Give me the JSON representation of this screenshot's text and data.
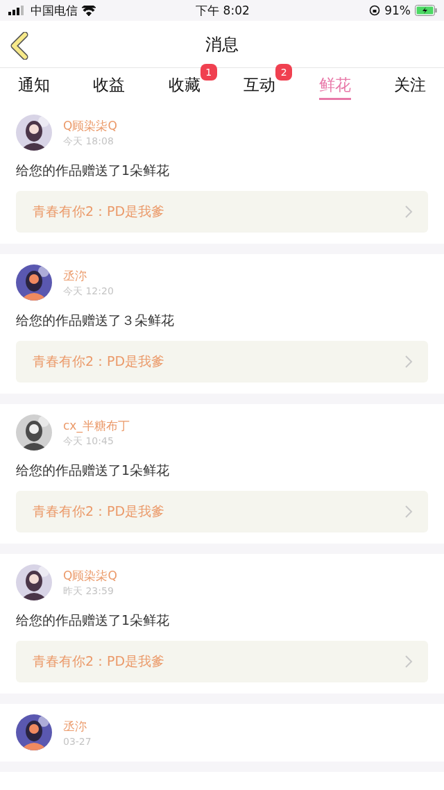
{
  "status_bar": {
    "carrier": "中国电信",
    "time": "下午 8:02",
    "battery": "91%"
  },
  "header": {
    "title": "消息"
  },
  "tabs": [
    {
      "label": "通知",
      "selected": false
    },
    {
      "label": "收益",
      "selected": false
    },
    {
      "label": "收藏",
      "selected": false,
      "badge": "1"
    },
    {
      "label": "互动",
      "selected": false,
      "badge": "2"
    },
    {
      "label": "鲜花",
      "selected": true
    },
    {
      "label": "关注",
      "selected": false
    }
  ],
  "messages": [
    {
      "name": "Q顾染柒Q",
      "time": "今天 18:08",
      "text": "给您的作品赠送了1朵鲜花",
      "work": "青春有你2：PD是我爹"
    },
    {
      "name": "丞沵",
      "time": "今天 12:20",
      "text": "给您的作品赠送了３朵鲜花",
      "work": "青春有你2：PD是我爹"
    },
    {
      "name": "cx_半糖布丁",
      "time": "今天 10:45",
      "text": "给您的作品赠送了1朵鲜花",
      "work": "青春有你2：PD是我爹"
    },
    {
      "name": "Q顾染柒Q",
      "time": "昨天 23:59",
      "text": "给您的作品赠送了1朵鲜花",
      "work": "青春有你2：PD是我爹"
    },
    {
      "name": "丞沵",
      "time": "03-27"
    }
  ]
}
